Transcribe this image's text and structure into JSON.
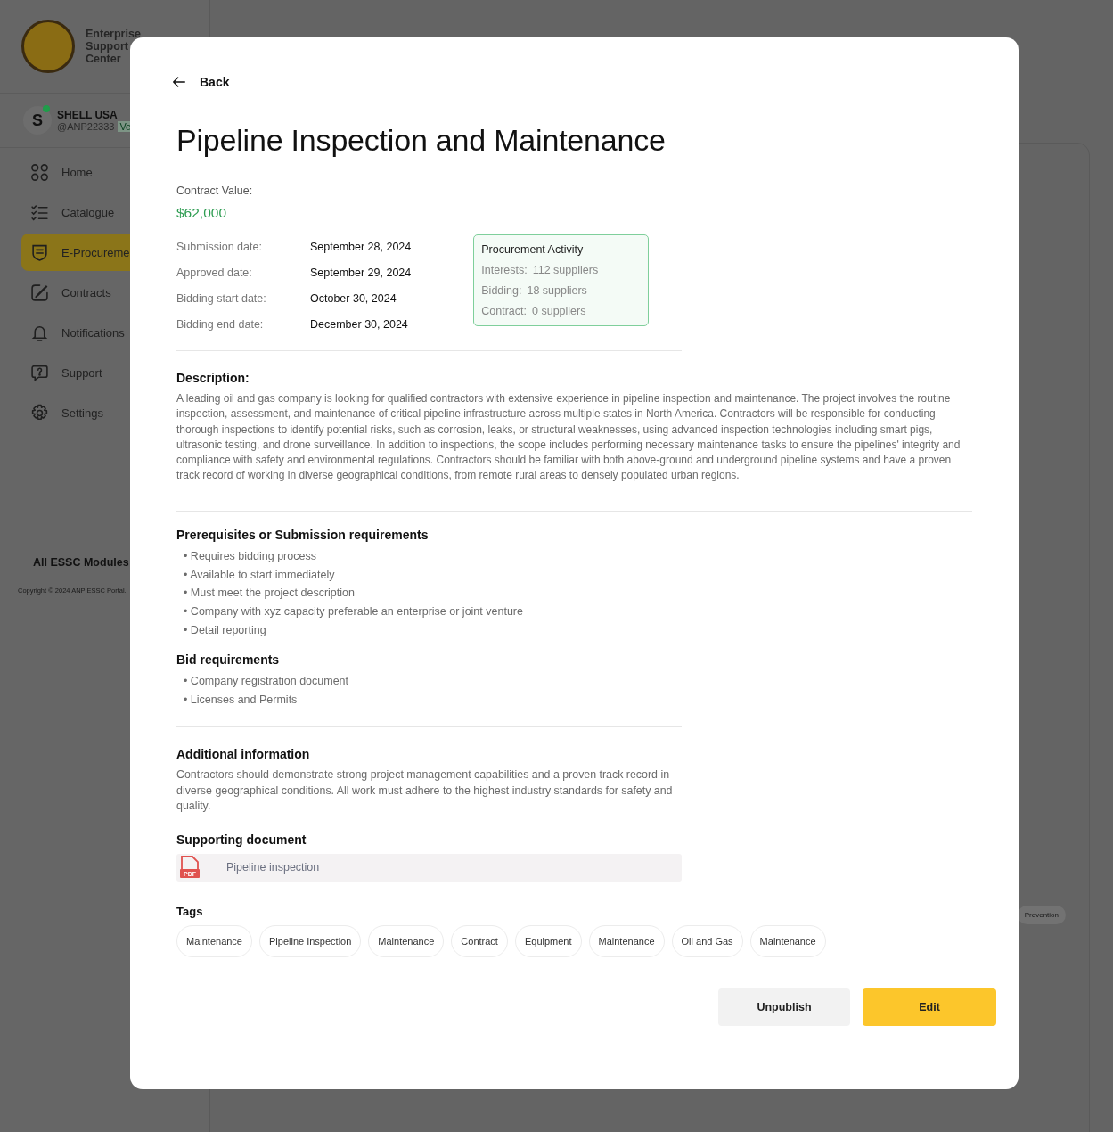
{
  "sidebar": {
    "brand": "Enterprise Support Center",
    "user": {
      "avatar_letter": "S",
      "online": true,
      "name": "SHELL USA",
      "handle": "@ANP22333",
      "badge": "Ve"
    },
    "nav": [
      {
        "label": "Home",
        "selected": false
      },
      {
        "label": "Catalogue",
        "selected": false
      },
      {
        "label": "E-Procureme",
        "selected": true
      },
      {
        "label": "Contracts",
        "selected": false
      },
      {
        "label": "Notifications",
        "selected": false
      },
      {
        "label": "Support",
        "selected": false
      },
      {
        "label": "Settings",
        "selected": false
      }
    ],
    "modules_link": "All ESSC Modules",
    "copyright": "Copyright © 2024 ANP ESSC Portal."
  },
  "background": {
    "tag": "Prevention"
  },
  "modal": {
    "back": "Back",
    "title": "Pipeline Inspection and Maintenance",
    "contract_value_label": "Contract Value:",
    "contract_value": "$62,000",
    "dates": [
      {
        "label": "Submission date:",
        "value": "September 28, 2024"
      },
      {
        "label": "Approved date:",
        "value": "September 29, 2024"
      },
      {
        "label": "Bidding start date:",
        "value": "October 30, 2024"
      },
      {
        "label": "Bidding end date:",
        "value": "December 30, 2024"
      }
    ],
    "activity": {
      "title": "Procurement Activity",
      "rows": [
        {
          "label": "Interests:",
          "value": "112 suppliers"
        },
        {
          "label": "Bidding:",
          "value": "18 suppliers"
        },
        {
          "label": "Contract:",
          "value": "0 suppliers"
        }
      ]
    },
    "description_heading": "Description:",
    "description": "A leading oil and gas company is looking for qualified contractors with extensive experience in pipeline inspection and maintenance. The project involves the routine inspection, assessment, and maintenance of critical pipeline infrastructure across multiple states in North America. Contractors will be responsible for conducting thorough inspections to identify potential risks, such as corrosion, leaks, or structural weaknesses, using advanced inspection technologies including smart pigs, ultrasonic testing, and drone surveillance. In addition to inspections, the scope includes performing necessary maintenance tasks to ensure the pipelines' integrity and compliance with safety and environmental regulations. Contractors should be familiar with both above-ground and underground pipeline systems and have a proven track record of working in diverse geographical conditions, from remote rural areas to densely populated urban regions.",
    "prerequisites_heading": "Prerequisites or Submission requirements",
    "prerequisites": [
      "• Requires bidding process",
      "• Available to start immediately",
      "• Must meet the project description",
      "• Company with xyz capacity preferable an enterprise or joint venture",
      "• Detail reporting"
    ],
    "bid_heading": "Bid requirements",
    "bid_requirements": [
      "• Company registration document",
      "• Licenses and Permits"
    ],
    "additional_heading": "Additional information",
    "additional": "Contractors should demonstrate strong project management capabilities and a proven track record in diverse geographical conditions. All work must adhere to the highest industry standards for safety and quality.",
    "document_heading": "Supporting document",
    "document": {
      "file_type": "PDF",
      "name": "Pipeline inspection"
    },
    "tags_heading": "Tags",
    "tags": [
      "Maintenance",
      "Pipeline Inspection",
      "Maintenance",
      "Contract",
      "Equipment",
      "Maintenance",
      "Oil and Gas",
      "Maintenance"
    ],
    "buttons": {
      "secondary": "Unpublish",
      "primary": "Edit"
    }
  }
}
